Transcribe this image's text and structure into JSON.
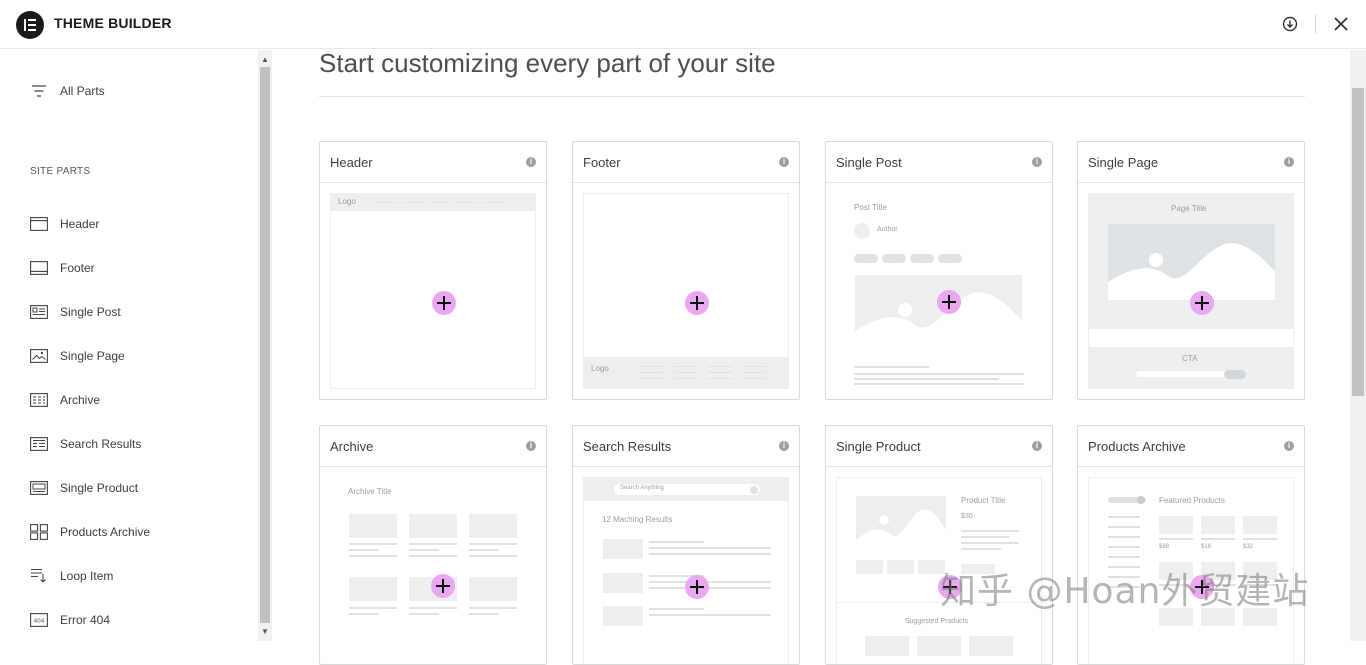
{
  "app": {
    "title": "THEME BUILDER"
  },
  "sidebar": {
    "all_parts": "All Parts",
    "heading": "SITE PARTS",
    "items": [
      {
        "label": "Header",
        "icon": "header-layout-icon"
      },
      {
        "label": "Footer",
        "icon": "footer-layout-icon"
      },
      {
        "label": "Single Post",
        "icon": "single-post-icon"
      },
      {
        "label": "Single Page",
        "icon": "single-page-icon"
      },
      {
        "label": "Archive",
        "icon": "archive-icon"
      },
      {
        "label": "Search Results",
        "icon": "search-results-icon"
      },
      {
        "label": "Single Product",
        "icon": "single-product-icon"
      },
      {
        "label": "Products Archive",
        "icon": "products-archive-icon"
      },
      {
        "label": "Loop Item",
        "icon": "loop-item-icon"
      },
      {
        "label": "Error 404",
        "icon": "error-404-icon"
      }
    ]
  },
  "main": {
    "title": "Start customizing every part of your site",
    "cards": [
      {
        "title": "Header",
        "preview": {
          "logo": "Logo"
        }
      },
      {
        "title": "Footer",
        "preview": {
          "logo": "Logo"
        }
      },
      {
        "title": "Single Post",
        "preview": {
          "post_title": "Post Title",
          "author": "Author"
        }
      },
      {
        "title": "Single Page",
        "preview": {
          "page_title": "Page Title",
          "cta": "CTA"
        }
      },
      {
        "title": "Archive",
        "preview": {
          "archive_title": "Archive Title"
        }
      },
      {
        "title": "Search Results",
        "preview": {
          "search_placeholder": "Search Anything",
          "results": "12 Maching Results"
        }
      },
      {
        "title": "Single Product",
        "preview": {
          "product_title": "Product Title",
          "price": "$30",
          "suggested": "Suggested Products"
        }
      },
      {
        "title": "Products Archive",
        "preview": {
          "featured": "Featured Products",
          "prices": [
            "$88",
            "$16",
            "$32"
          ]
        }
      }
    ]
  },
  "watermark": "知乎 @Hoan外贸建站",
  "colors": {
    "accent": "#e9a8f0",
    "text": "#3a3f45",
    "border": "#d8dbde"
  }
}
